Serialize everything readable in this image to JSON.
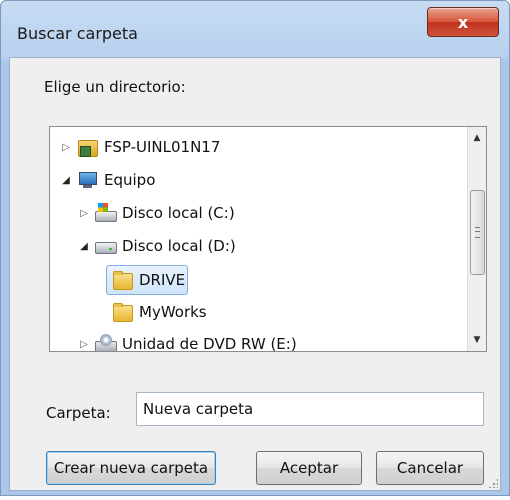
{
  "window": {
    "title": "Buscar carpeta",
    "close_glyph": "x"
  },
  "dialog": {
    "prompt": "Elige un directorio:"
  },
  "tree": {
    "items": [
      {
        "label": "FSP-UINL01N17",
        "icon": "network-computer-icon",
        "expander": "collapsed",
        "level": 0
      },
      {
        "label": "Equipo",
        "icon": "computer-icon",
        "expander": "expanded",
        "level": 0
      },
      {
        "label": "Disco local (C:)",
        "icon": "windows-drive-icon",
        "expander": "collapsed",
        "level": 1
      },
      {
        "label": "Disco local (D:)",
        "icon": "hard-drive-icon",
        "expander": "expanded",
        "level": 1
      },
      {
        "label": "DRIVE",
        "icon": "folder-icon",
        "expander": "none",
        "level": 2,
        "selected": true
      },
      {
        "label": "MyWorks",
        "icon": "folder-icon",
        "expander": "none",
        "level": 2
      },
      {
        "label": "Unidad de DVD RW (E:)",
        "icon": "dvd-drive-icon",
        "expander": "collapsed",
        "level": 1
      }
    ]
  },
  "folder_field": {
    "label": "Carpeta:",
    "value": "Nueva carpeta"
  },
  "buttons": {
    "new_folder": "Crear nueva carpeta",
    "ok": "Aceptar",
    "cancel": "Cancelar"
  },
  "colors": {
    "title_bar": "#b9d1ee",
    "close_button": "#c7402b",
    "selection": "#cfe4fa",
    "focus_border": "#3c7fb1"
  }
}
